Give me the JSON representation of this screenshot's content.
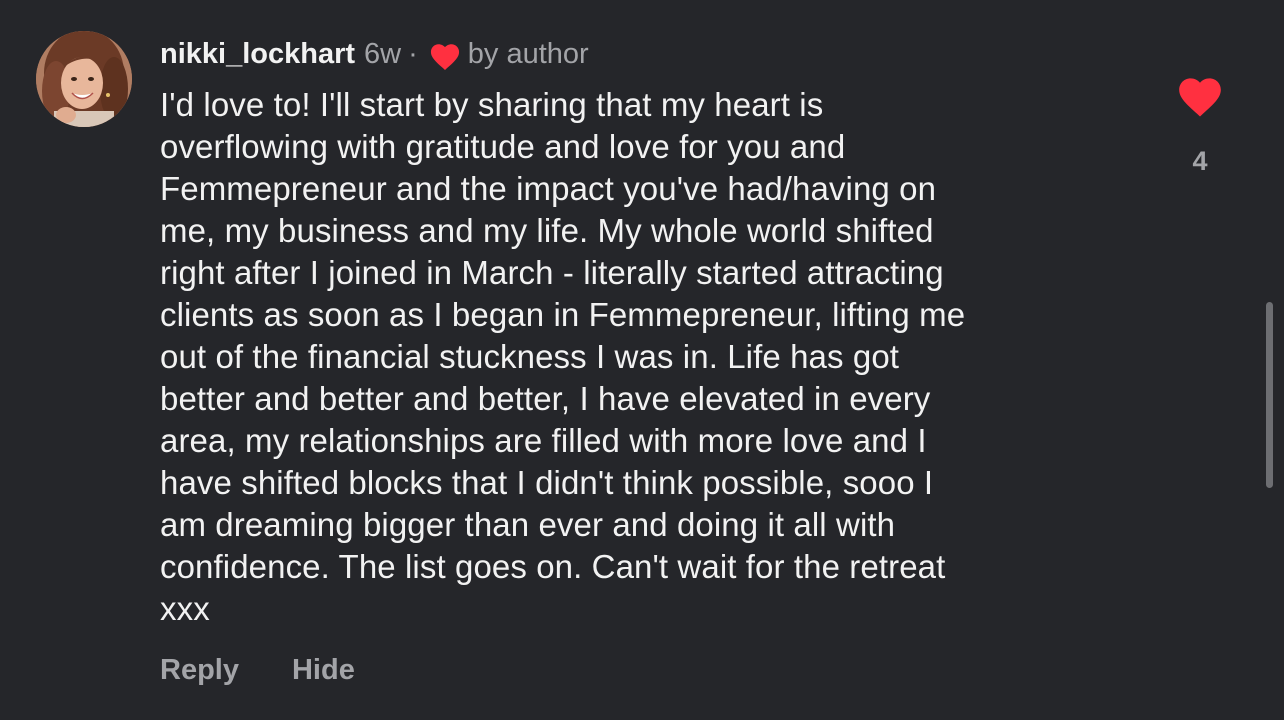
{
  "comment": {
    "username": "nikki_lockhart",
    "time": "6w",
    "separator": "·",
    "author_badge": "by author",
    "body": "I'd love to! I'll start by sharing that my heart is\noverflowing with gratitude and love for you and\nFemmepreneur and the impact you've had/having on\nme, my business and my life. My whole world shifted\nright after I joined in March - literally started attracting\nclients as soon as I began in Femmepreneur, lifting me\nout of the financial stuckness I was in. Life has got\nbetter and better and better, I have elevated in every\narea, my relationships are filled with more love and I\nhave shifted blocks that I didn't think possible, sooo I\nam dreaming bigger than ever and doing it all with\nconfidence. The list goes on. Can't wait for the retreat\nxxx",
    "like_count": "4",
    "liked": true
  },
  "actions": {
    "reply_label": "Reply",
    "hide_label": "Hide"
  },
  "icons": {
    "avatar": "user-avatar-photo",
    "author_like": "heart-icon",
    "like_button": "heart-icon"
  },
  "colors": {
    "background": "#25262a",
    "heart": "#ff3040",
    "text_primary": "#f2f2f2",
    "text_secondary": "#a3a4a8"
  }
}
